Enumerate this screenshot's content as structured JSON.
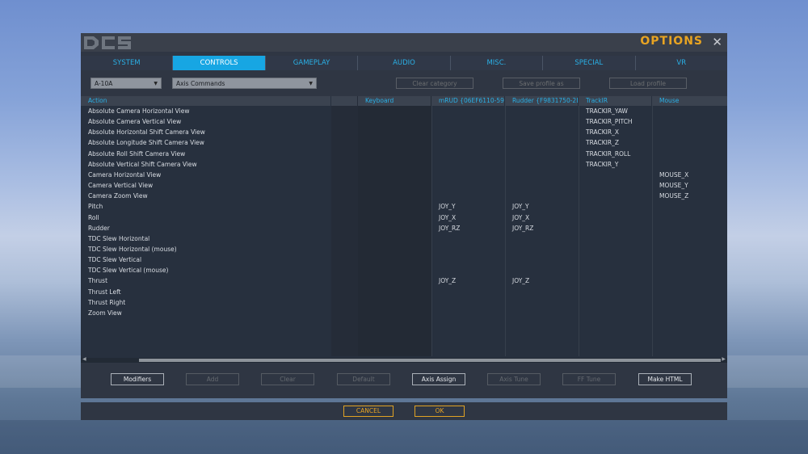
{
  "window": {
    "title": "OPTIONS",
    "logo_text": "DCS"
  },
  "tabs": [
    "SYSTEM",
    "CONTROLS",
    "GAMEPLAY",
    "AUDIO",
    "MISC.",
    "SPECIAL",
    "VR"
  ],
  "active_tab": "CONTROLS",
  "toolbar": {
    "aircraft": "A-10A",
    "category": "Axis Commands",
    "clear_category": "Clear category",
    "save_profile": "Save profile as",
    "load_profile": "Load profile"
  },
  "columns": [
    "Action",
    "",
    "Keyboard",
    "mRUD {06EF6110-590-",
    "Rudder {F9831750-2B",
    "TrackIR",
    "Mouse"
  ],
  "rows": [
    [
      "Absolute Camera Horizontal View",
      "",
      "",
      "",
      "",
      "TRACKIR_YAW",
      ""
    ],
    [
      "Absolute Camera Vertical View",
      "",
      "",
      "",
      "",
      "TRACKIR_PITCH",
      ""
    ],
    [
      "Absolute Horizontal Shift Camera View",
      "",
      "",
      "",
      "",
      "TRACKIR_X",
      ""
    ],
    [
      "Absolute Longitude Shift Camera View",
      "",
      "",
      "",
      "",
      "TRACKIR_Z",
      ""
    ],
    [
      "Absolute Roll Shift Camera View",
      "",
      "",
      "",
      "",
      "TRACKIR_ROLL",
      ""
    ],
    [
      "Absolute Vertical Shift Camera View",
      "",
      "",
      "",
      "",
      "TRACKIR_Y",
      ""
    ],
    [
      "Camera Horizontal View",
      "",
      "",
      "",
      "",
      "",
      "MOUSE_X"
    ],
    [
      "Camera Vertical View",
      "",
      "",
      "",
      "",
      "",
      "MOUSE_Y"
    ],
    [
      "Camera Zoom View",
      "",
      "",
      "",
      "",
      "",
      "MOUSE_Z"
    ],
    [
      "Pitch",
      "",
      "",
      "JOY_Y",
      "JOY_Y",
      "",
      ""
    ],
    [
      "Roll",
      "",
      "",
      "JOY_X",
      "JOY_X",
      "",
      ""
    ],
    [
      "Rudder",
      "",
      "",
      "JOY_RZ",
      "JOY_RZ",
      "",
      ""
    ],
    [
      "TDC Slew Horizontal",
      "",
      "",
      "",
      "",
      "",
      ""
    ],
    [
      "TDC Slew Horizontal (mouse)",
      "",
      "",
      "",
      "",
      "",
      ""
    ],
    [
      "TDC Slew Vertical",
      "",
      "",
      "",
      "",
      "",
      ""
    ],
    [
      "TDC Slew Vertical (mouse)",
      "",
      "",
      "",
      "",
      "",
      ""
    ],
    [
      "Thrust",
      "",
      "",
      "JOY_Z",
      "JOY_Z",
      "",
      ""
    ],
    [
      "Thrust Left",
      "",
      "",
      "",
      "",
      "",
      ""
    ],
    [
      "Thrust Right",
      "",
      "",
      "",
      "",
      "",
      ""
    ],
    [
      "Zoom View",
      "",
      "",
      "",
      "",
      "",
      ""
    ]
  ],
  "bottom_buttons": [
    {
      "label": "Modifiers",
      "enabled": true
    },
    {
      "label": "Add",
      "enabled": false
    },
    {
      "label": "Clear",
      "enabled": false
    },
    {
      "label": "Default",
      "enabled": false
    },
    {
      "label": "Axis Assign",
      "enabled": true
    },
    {
      "label": "Axis Tune",
      "enabled": false
    },
    {
      "label": "FF Tune",
      "enabled": false
    },
    {
      "label": "Make HTML",
      "enabled": true
    }
  ],
  "footer": {
    "cancel": "CANCEL",
    "ok": "OK"
  },
  "colors": {
    "accent": "#17a6e3",
    "title": "#e8a422",
    "panel": "#2f3643"
  }
}
